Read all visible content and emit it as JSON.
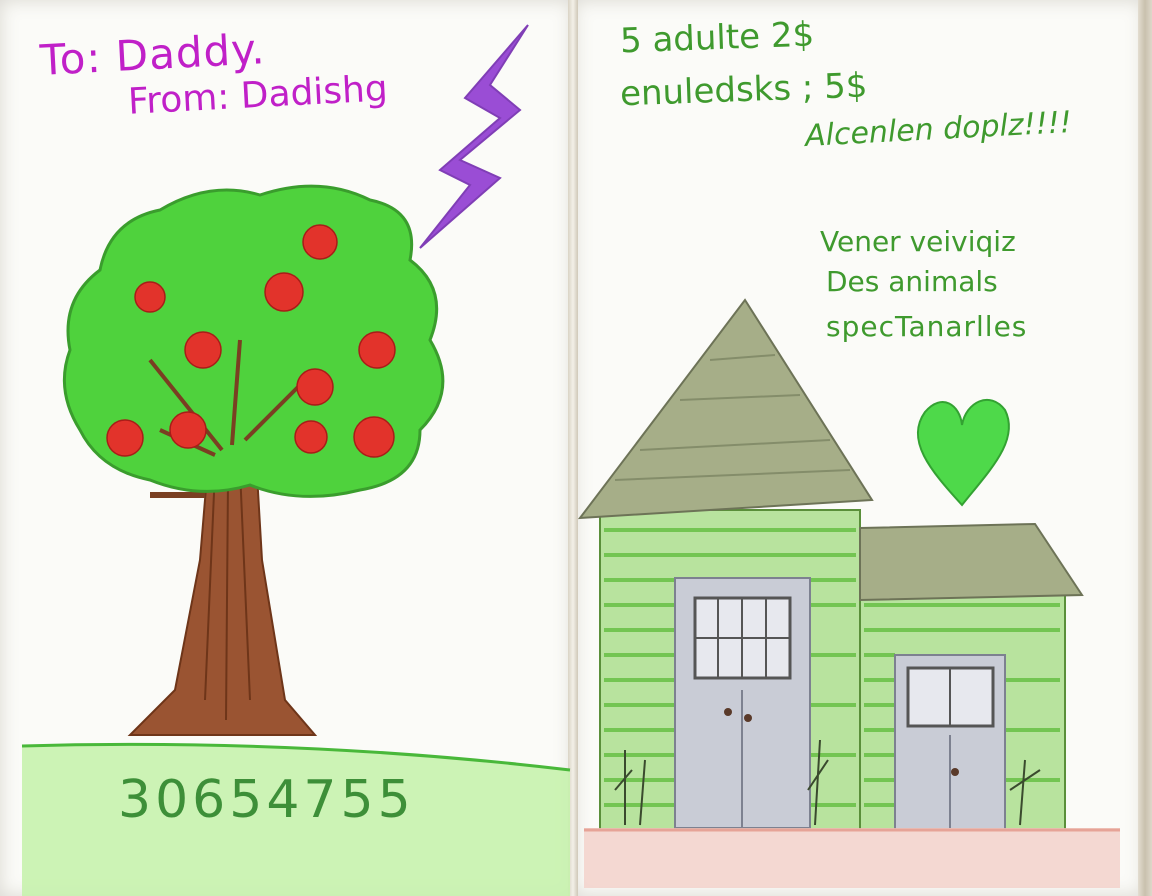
{
  "left_page": {
    "to_line": "To: Daddy.",
    "from_line": "From: Dadishg",
    "number": "30654755"
  },
  "right_page": {
    "price_line_1": "5 adulte 2$",
    "price_line_2": "enuledsks ; 5$",
    "exclaim": "Alcenlen doplz!!!!",
    "caption_line_1": "Vener veiviqiz",
    "caption_line_2": "Des animals",
    "caption_line_3": "specTanarlles"
  },
  "colors": {
    "magenta_text": "#c020c8",
    "green_text": "#3f9a2e",
    "lightning": "#8a2fd0",
    "foliage": "#4fd23d",
    "apple": "#e2332b",
    "trunk": "#8b4a2a",
    "grass": "#b8ee9a",
    "roof": "#8f9a72",
    "house_stripes": "#6cc24a",
    "heart": "#4ed94a",
    "door": "#c9ccd6",
    "ground": "#e6a397"
  },
  "icons": [
    "lightning-bolt",
    "apple-tree",
    "house",
    "heart"
  ]
}
